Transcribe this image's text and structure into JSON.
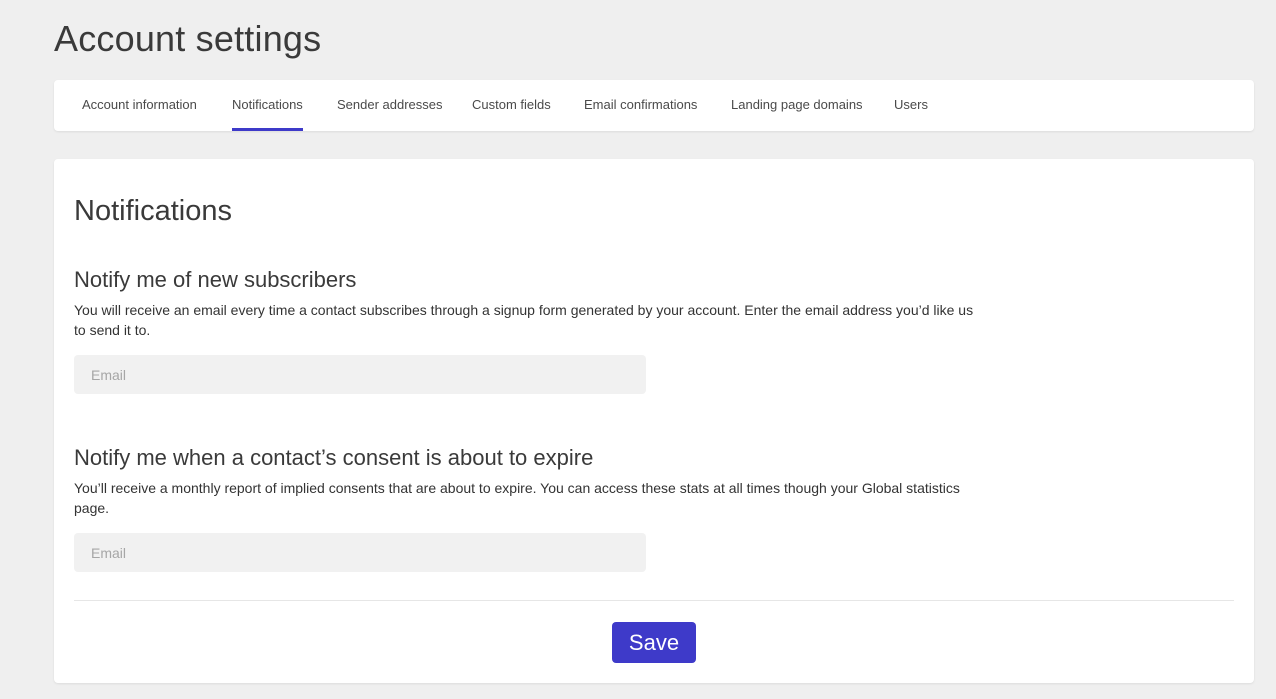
{
  "page": {
    "title": "Account settings"
  },
  "tabs": [
    {
      "label": "Account information",
      "active": false
    },
    {
      "label": "Notifications",
      "active": true
    },
    {
      "label": "Sender addresses",
      "active": false
    },
    {
      "label": "Custom fields",
      "active": false
    },
    {
      "label": "Email confirmations",
      "active": false
    },
    {
      "label": "Landing page domains",
      "active": false
    },
    {
      "label": "Users",
      "active": false
    }
  ],
  "notifications": {
    "title": "Notifications",
    "new_subscribers": {
      "title": "Notify me of new subscribers",
      "description": "You will receive an email every time a contact subscribes through a signup form generated by your account. Enter the email address you’d like us to send it to.",
      "email_value": "",
      "email_placeholder": "Email"
    },
    "consent_expiry": {
      "title": "Notify me when a contact’s consent is about to expire",
      "description": "You’ll receive a monthly report of implied consents that are about to expire. You can access these stats at all times though your Global statistics page.",
      "email_value": "",
      "email_placeholder": "Email"
    },
    "save_label": "Save"
  },
  "colors": {
    "accent": "#3e3ac9",
    "background": "#efefef",
    "card": "#ffffff",
    "input_bg": "#f1f1f1"
  }
}
